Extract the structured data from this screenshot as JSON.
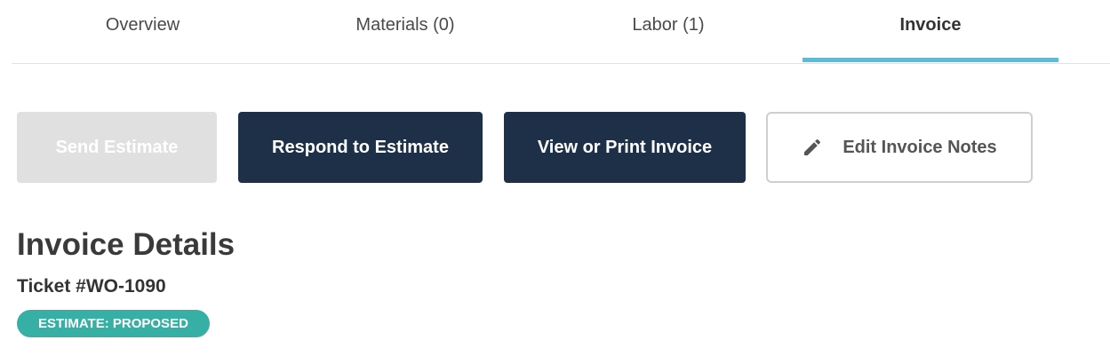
{
  "tabs": [
    {
      "label": "Overview",
      "active": false
    },
    {
      "label": "Materials (0)",
      "active": false
    },
    {
      "label": "Labor (1)",
      "active": false
    },
    {
      "label": "Invoice",
      "active": true
    }
  ],
  "actions": {
    "send_estimate": "Send Estimate",
    "respond_to_estimate": "Respond to Estimate",
    "view_print_invoice": "View or Print Invoice",
    "edit_invoice_notes": "Edit Invoice Notes",
    "edit_icon": "pencil-icon"
  },
  "details": {
    "title": "Invoice Details",
    "ticket": "Ticket #WO-1090",
    "status_badge": "ESTIMATE: PROPOSED"
  },
  "colors": {
    "accent_tab": "#4fc1e0",
    "primary_button": "#1e3048",
    "disabled_button": "#e0e0e0",
    "badge": "#36b0a5"
  }
}
